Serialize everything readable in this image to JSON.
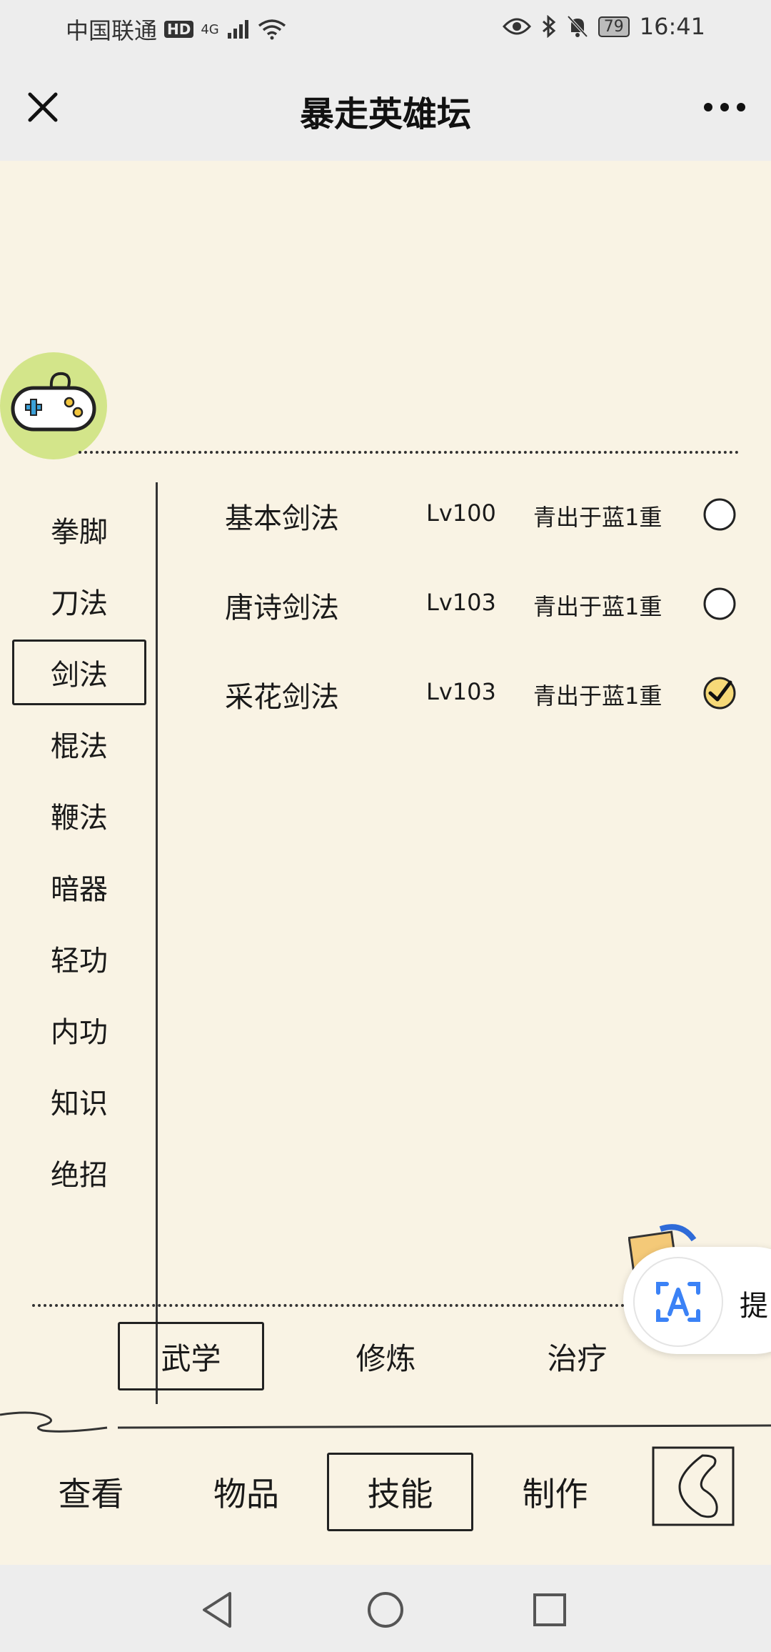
{
  "status_bar": {
    "carrier": "中国联通",
    "hd_badge": "HD",
    "network": "4G",
    "battery": "79",
    "time": "16:41"
  },
  "header": {
    "title": "暴走英雄坛"
  },
  "categories": [
    {
      "label": "拳脚",
      "selected": false
    },
    {
      "label": "刀法",
      "selected": false
    },
    {
      "label": "剑法",
      "selected": true
    },
    {
      "label": "棍法",
      "selected": false
    },
    {
      "label": "鞭法",
      "selected": false
    },
    {
      "label": "暗器",
      "selected": false
    },
    {
      "label": "轻功",
      "selected": false
    },
    {
      "label": "内功",
      "selected": false
    },
    {
      "label": "知识",
      "selected": false
    },
    {
      "label": "绝招",
      "selected": false
    }
  ],
  "skills": [
    {
      "name": "基本剑法",
      "level": "Lv100",
      "tier": "青出于蓝1重",
      "checked": false
    },
    {
      "name": "唐诗剑法",
      "level": "Lv103",
      "tier": "青出于蓝1重",
      "checked": false
    },
    {
      "name": "采花剑法",
      "level": "Lv103",
      "tier": "青出于蓝1重",
      "checked": true
    }
  ],
  "floating_pill": {
    "text": "提"
  },
  "sub_tabs": [
    {
      "label": "武学",
      "selected": true
    },
    {
      "label": "修炼",
      "selected": false
    },
    {
      "label": "治疗",
      "selected": false
    }
  ],
  "main_tabs": [
    {
      "label": "查看",
      "selected": false
    },
    {
      "label": "物品",
      "selected": false
    },
    {
      "label": "技能",
      "selected": true
    },
    {
      "label": "制作",
      "selected": false
    }
  ],
  "colors": {
    "background": "#f9f3e4",
    "gamepad_bg": "#d3e58a",
    "chrome": "#ededed",
    "ocr_blue": "#3b82f6"
  }
}
